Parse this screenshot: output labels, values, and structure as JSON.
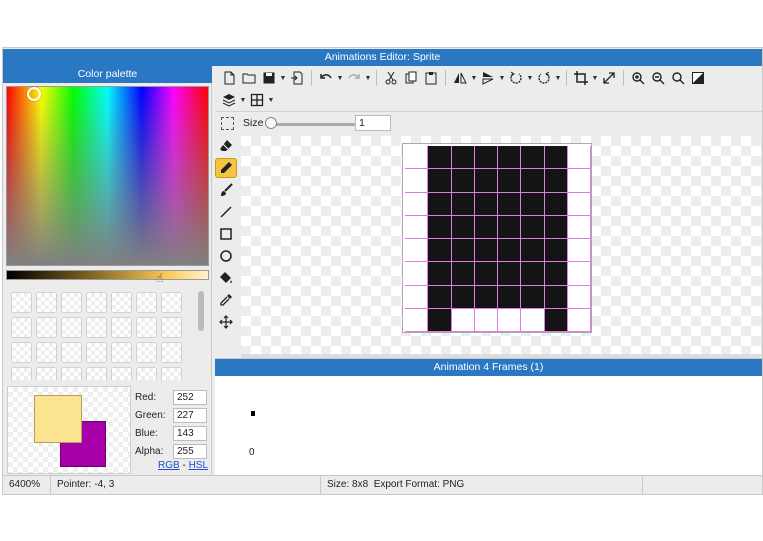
{
  "window": {
    "title": "Animations Editor: Sprite"
  },
  "palette": {
    "title": "Color palette",
    "swatch_count": 28,
    "primary_color": "#fce38f",
    "secondary_color": "#a700aa",
    "channels": [
      {
        "label": "Red:",
        "value": "252"
      },
      {
        "label": "Green:",
        "value": "227"
      },
      {
        "label": "Blue:",
        "value": "143"
      },
      {
        "label": "Alpha:",
        "value": "255"
      }
    ],
    "mode_rgb": "RGB",
    "mode_sep": " - ",
    "mode_hsl": "HSL"
  },
  "toolbar": {
    "row1": [
      "new-file-icon",
      "open-folder-icon",
      "save-icon",
      "export-icon",
      "undo-icon",
      "redo-icon",
      "cut-icon",
      "copy-icon",
      "paste-icon",
      "flip-horizontal-icon",
      "flip-vertical-icon",
      "rotate-left-icon",
      "rotate-right-icon",
      "crop-icon",
      "resize-icon",
      "zoom-in-icon",
      "zoom-out-icon",
      "zoom-fit-icon",
      "invert-icon"
    ],
    "row2": [
      "layers-icon",
      "grid-icon"
    ],
    "size_label": "Size",
    "size_value": "1"
  },
  "tools": [
    "eraser-icon",
    "pencil-icon",
    "brush-icon",
    "line-icon",
    "rectangle-icon",
    "ellipse-icon",
    "fill-bucket-icon",
    "eyedropper-icon",
    "move-icon"
  ],
  "active_tool": "pencil-icon",
  "canvas": {
    "pixels": [
      [
        0,
        1,
        1,
        1,
        1,
        1,
        1,
        0
      ],
      [
        0,
        1,
        1,
        1,
        1,
        1,
        1,
        0
      ],
      [
        0,
        1,
        1,
        1,
        1,
        1,
        1,
        0
      ],
      [
        0,
        1,
        1,
        1,
        1,
        1,
        1,
        0
      ],
      [
        0,
        1,
        1,
        1,
        1,
        1,
        1,
        0
      ],
      [
        0,
        1,
        1,
        1,
        1,
        1,
        1,
        0
      ],
      [
        0,
        1,
        1,
        1,
        1,
        1,
        1,
        0
      ],
      [
        0,
        1,
        0,
        0,
        0,
        0,
        1,
        0
      ]
    ],
    "pixel_color": "#141414",
    "grid_color": "#e07be0"
  },
  "animation": {
    "title": "Animation 4 Frames (1)",
    "frame_index": "0"
  },
  "status": {
    "zoom": "6400%",
    "pointer": "Pointer: -4, 3",
    "size": "Size: 8x8",
    "export_format": "Export Format: PNG"
  }
}
